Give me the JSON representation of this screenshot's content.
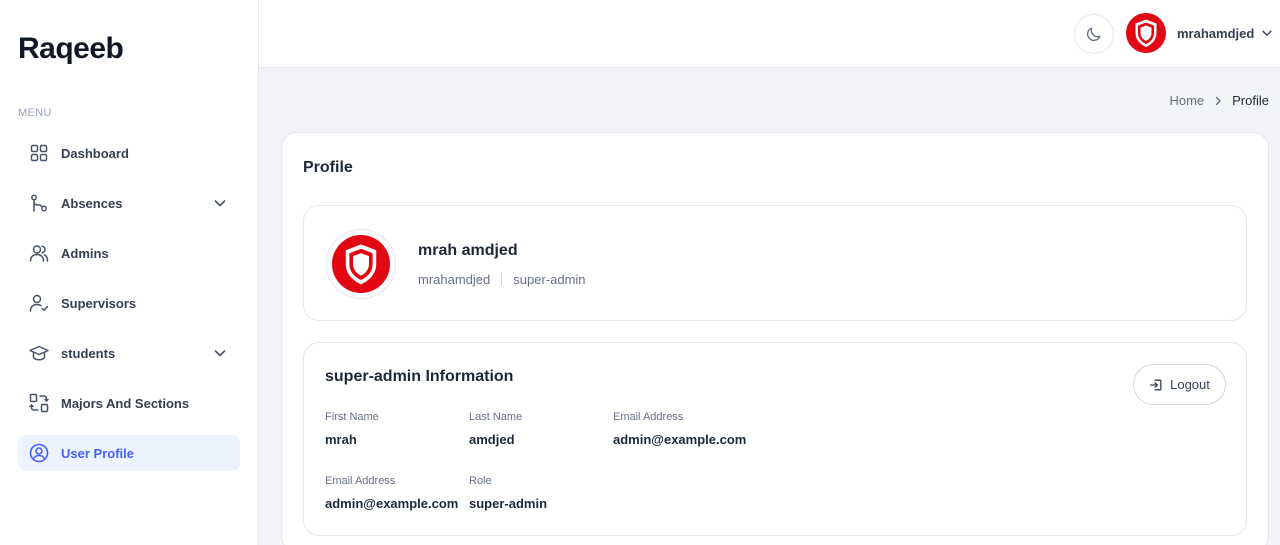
{
  "sidebar": {
    "logo": "Raqeeb",
    "menu_label": "MENU",
    "items": [
      {
        "label": "Dashboard",
        "icon": "grid-icon"
      },
      {
        "label": "Absences",
        "icon": "git-branch-icon"
      },
      {
        "label": "Admins",
        "icon": "users-icon"
      },
      {
        "label": "Supervisors",
        "icon": "user-check-icon"
      },
      {
        "label": "students",
        "icon": "graduation-cap-icon"
      },
      {
        "label": "Majors And Sections",
        "icon": "swap-icon"
      },
      {
        "label": "User Profile",
        "icon": "user-circle-icon",
        "active": true
      }
    ]
  },
  "header": {
    "username": "mrahamdjed"
  },
  "breadcrumb": {
    "home": "Home",
    "current": "Profile"
  },
  "profile": {
    "title": "Profile",
    "full_name": "mrah amdjed",
    "username": "mrahamdjed",
    "role": "super-admin"
  },
  "info": {
    "title": "super-admin Information",
    "logout_label": "Logout",
    "fields": [
      {
        "label": "First Name",
        "value": "mrah"
      },
      {
        "label": "Last Name",
        "value": "amdjed"
      },
      {
        "label": "Email Address",
        "value": "admin@example.com"
      },
      {
        "label": "Email Address",
        "value": "admin@example.com"
      },
      {
        "label": "Role",
        "value": "super-admin"
      }
    ]
  },
  "colors": {
    "accent": "#465fff",
    "active_bg": "#ecf3ff",
    "avatar_red": "#e30613"
  }
}
